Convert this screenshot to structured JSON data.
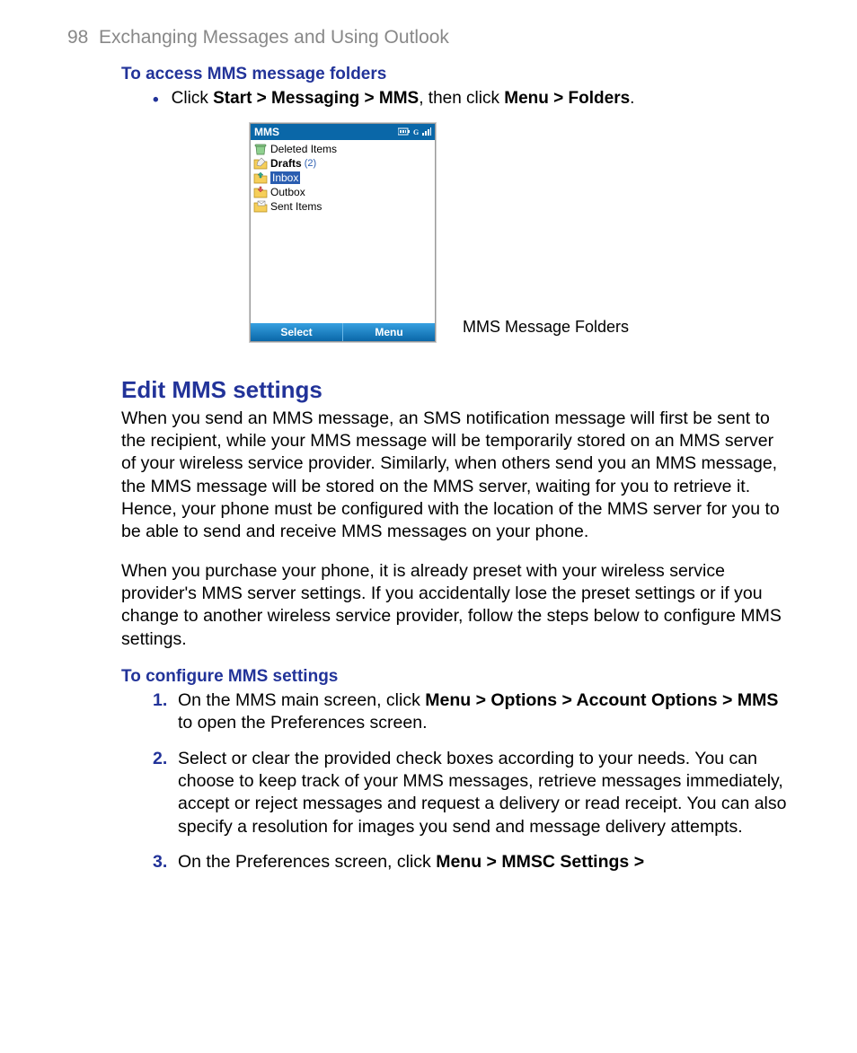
{
  "header": {
    "page_number": "98",
    "chapter_title": "Exchanging Messages and Using Outlook"
  },
  "section1": {
    "heading": "To access MMS message folders",
    "bullet_pre": "Click ",
    "bullet_bold1": "Start > Messaging > MMS",
    "bullet_mid": ", then click ",
    "bullet_bold2": "Menu > Folders",
    "bullet_post": "."
  },
  "phone": {
    "title": "MMS",
    "folders": {
      "deleted": "Deleted Items",
      "drafts": "Drafts",
      "drafts_count": "(2)",
      "inbox": "Inbox",
      "outbox": "Outbox",
      "sent": "Sent Items"
    },
    "softkey_left": "Select",
    "softkey_right": "Menu",
    "caption": "MMS Message Folders"
  },
  "section2": {
    "heading": "Edit MMS settings",
    "para1": "When you send an MMS message, an SMS notification message will first be sent to the recipient, while your MMS message will be temporarily stored on an MMS server of your wireless service provider. Similarly, when others send you an MMS message, the MMS message will be stored on the MMS server, waiting for you to retrieve it. Hence, your phone must be configured with the location of the MMS server for you to be able to send and receive MMS messages on your phone.",
    "para2": "When you purchase your phone, it is already preset with your wireless service provider's MMS server settings. If you accidentally lose the preset settings or if you change to another wireless service provider, follow the steps below to configure MMS settings."
  },
  "section3": {
    "heading": "To configure MMS settings",
    "steps": {
      "s1_num": "1.",
      "s1_pre": "On the MMS main screen, click ",
      "s1_bold": "Menu > Options > Account Options > MMS",
      "s1_post": " to open the Preferences screen.",
      "s2_num": "2.",
      "s2_text": "Select or clear the provided check boxes according to your needs. You can choose to keep track of your MMS messages, retrieve messages immediately, accept or reject messages and request a delivery or read receipt. You can also specify a resolution for images you send and message delivery attempts.",
      "s3_num": "3.",
      "s3_pre": "On the Preferences screen, click ",
      "s3_bold": "Menu > MMSC Settings >"
    }
  }
}
